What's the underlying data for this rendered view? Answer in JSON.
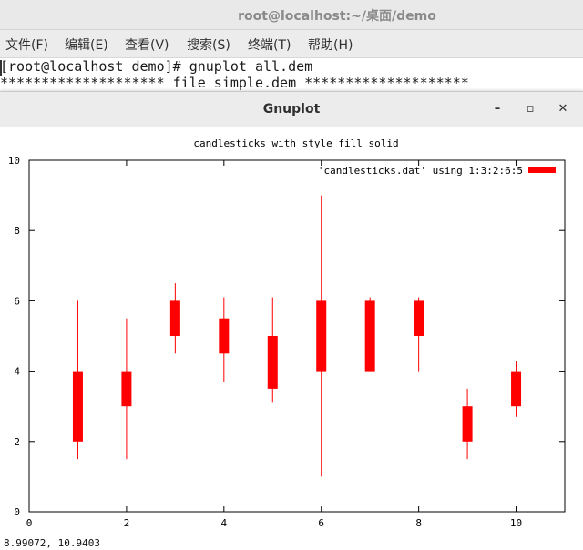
{
  "terminal": {
    "title": "root@localhost:~/桌面/demo",
    "menu": [
      "文件(F)",
      "编辑(E)",
      "查看(V)",
      "搜索(S)",
      "终端(T)",
      "帮助(H)"
    ],
    "lines": [
      "[root@localhost demo]# gnuplot all.dem",
      "******************** file simple.dem ********************"
    ]
  },
  "gnuplot_window": {
    "title": "Gnuplot",
    "minimize_label": "–",
    "maximize_label": "▫",
    "close_label": "✕",
    "status": "8.99072,  10.9403"
  },
  "chart_data": {
    "type": "candlestick",
    "title": "candlesticks with style fill solid",
    "legend": "'candlesticks.dat' using 1:3:2:6:5",
    "legend_position": "top-right",
    "xlim": [
      0,
      11
    ],
    "ylim": [
      0,
      10
    ],
    "xticks": [
      0,
      2,
      4,
      6,
      8,
      10
    ],
    "yticks": [
      0,
      2,
      4,
      6,
      8,
      10
    ],
    "color": "#ff0000",
    "candles": [
      {
        "x": 1,
        "open": 2,
        "low": 1.5,
        "high": 6,
        "close": 4
      },
      {
        "x": 2,
        "open": 3,
        "low": 1.5,
        "high": 5.5,
        "close": 4
      },
      {
        "x": 3,
        "open": 5,
        "low": 4.5,
        "high": 6.5,
        "close": 6
      },
      {
        "x": 4,
        "open": 4.5,
        "low": 3.7,
        "high": 6.1,
        "close": 5.5
      },
      {
        "x": 5,
        "open": 3.5,
        "low": 3.1,
        "high": 6.1,
        "close": 5
      },
      {
        "x": 6,
        "open": 4,
        "low": 1,
        "high": 9,
        "close": 6
      },
      {
        "x": 7,
        "open": 4,
        "low": 4,
        "high": 6.1,
        "close": 6
      },
      {
        "x": 8,
        "open": 5,
        "low": 4,
        "high": 6.1,
        "close": 6
      },
      {
        "x": 9,
        "open": 2,
        "low": 1.5,
        "high": 3.5,
        "close": 3
      },
      {
        "x": 10,
        "open": 3,
        "low": 2.7,
        "high": 4.3,
        "close": 4
      }
    ]
  }
}
